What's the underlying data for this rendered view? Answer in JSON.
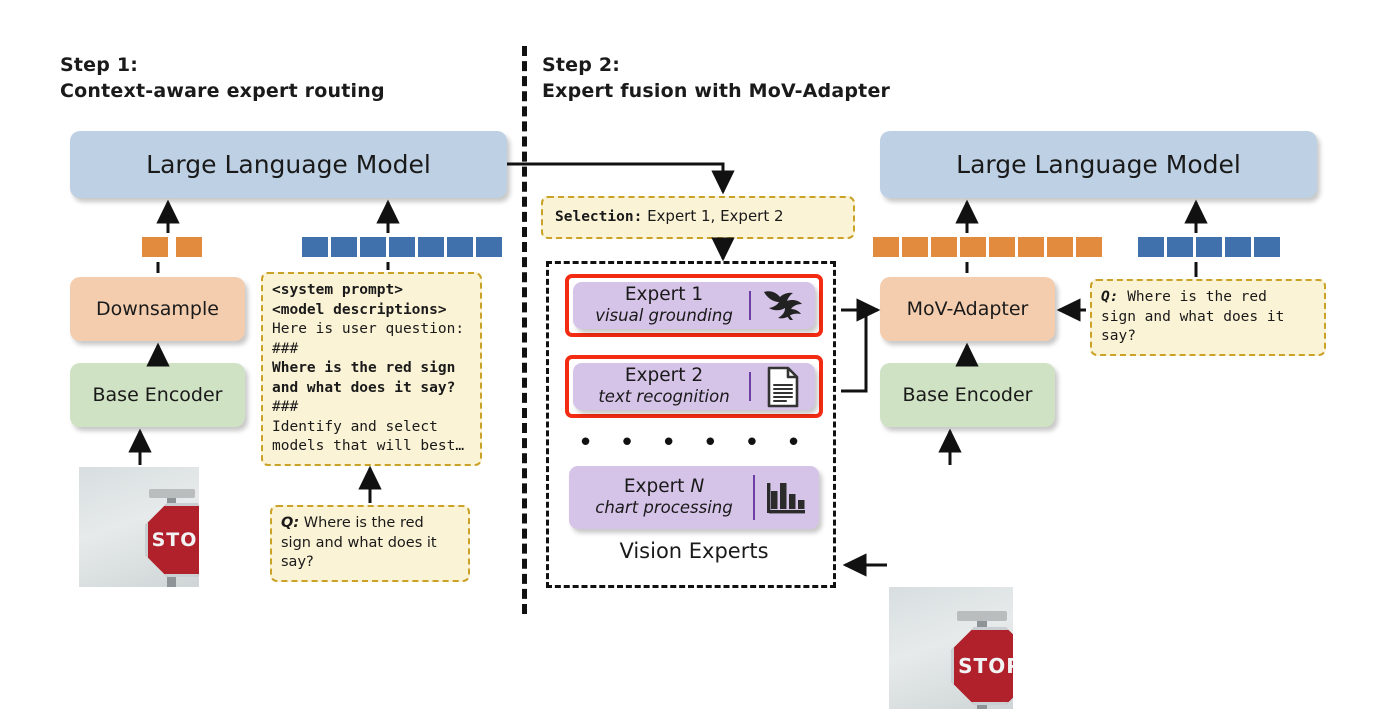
{
  "steps": {
    "left": {
      "title": "Step 1:\nContext-aware expert routing"
    },
    "right": {
      "title": "Step 2:\nExpert fusion with MoV-Adapter"
    }
  },
  "blocks": {
    "llm_left": "Large Language Model",
    "llm_right": "Large Language Model",
    "downsample": "Downsample",
    "base_encoder_left": "Base Encoder",
    "mov_adapter": "MoV-Adapter",
    "base_encoder_right": "Base Encoder"
  },
  "tokens": {
    "left_orange_count": 2,
    "left_blue_count": 7,
    "right_orange_count": 8,
    "right_blue_count": 5,
    "orange_color": "#e28a3e",
    "blue_color": "#4071ad"
  },
  "prompt_note": {
    "line1": "<system prompt>",
    "line2": "<model descriptions>",
    "line3": "Here is user question:",
    "line4": "###",
    "line5": "Where is the red sign",
    "line6": "and what does it say?",
    "line7": "###",
    "line8": "Identify and select",
    "line9": "models that will best…"
  },
  "question_left": {
    "label": "Q:",
    "line1": " Where is the red",
    "line2": "sign and what does it",
    "line3": "say?"
  },
  "question_right": {
    "label": "Q:",
    "line1": " Where is the red",
    "line2": "sign and what does it",
    "line3": "say?"
  },
  "selection_note": {
    "label": "Selection:",
    "value": " Expert 1, Expert 2"
  },
  "experts": {
    "panel_label": "Vision Experts",
    "dots": "• • • • • •",
    "items": [
      {
        "name": "Expert 1",
        "name_italic": "",
        "role": "visual grounding",
        "icon": "bird-icon",
        "highlighted": true
      },
      {
        "name": "Expert 2",
        "name_italic": "",
        "role": "text recognition",
        "icon": "document-icon",
        "highlighted": true
      },
      {
        "name": "Expert ",
        "name_italic": "N",
        "role": "chart processing",
        "icon": "bar-chart-icon",
        "highlighted": false
      }
    ],
    "box_color": "#d5c3e8",
    "highlight_color": "#f22b12"
  },
  "photo": {
    "sign_text": "STOP",
    "alt": "stop-sign-photo"
  },
  "palette": {
    "llm_blue": "#bed0e4",
    "adapter_peach": "#f4cdae",
    "encoder_green": "#cfe2c3",
    "note_yellow": "#fbf3d5",
    "note_border": "#c9a227"
  }
}
